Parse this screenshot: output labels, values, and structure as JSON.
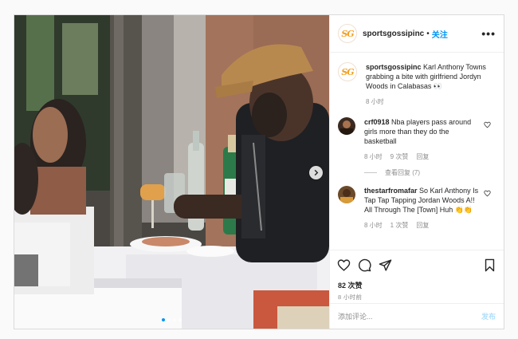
{
  "post": {
    "username": "sportsgossipinc",
    "logo_text": "SG",
    "separator": "•",
    "follow_label": "关注",
    "more_label": "•••",
    "caption": {
      "username": "sportsgossipinc",
      "text": "Karl Anthony Towns grabbing a bite with girlfriend Jordyn Woods in Calabasas 👀",
      "time": "8 小时"
    },
    "comments": [
      {
        "username": "crf0918",
        "text": "Nba players pass around girls more than they do the basketball",
        "time": "8 小时",
        "likes": "9 次赞",
        "reply_label": "回复",
        "view_replies": "查看回复 (7)"
      },
      {
        "username": "thestarfromafar",
        "text": "So Karl Anthony Is Tap Tap Tapping Jordan Woods A!! All Through The [Town] Huh 👏👏",
        "time": "8 小时",
        "likes": "1 次赞",
        "reply_label": "回复"
      }
    ],
    "likes_count": "82 次赞",
    "posted_ago": "8 小时前",
    "comment_placeholder": "添加评论...",
    "post_label": "发布"
  },
  "carousel": {
    "total": 4,
    "active_index": 0
  },
  "colors": {
    "accent": "#0095f6",
    "logo": "#f2a01e",
    "muted": "#8e8e8e"
  },
  "icons": [
    "next-arrow-icon",
    "heart-icon",
    "comment-icon",
    "share-icon",
    "bookmark-icon"
  ]
}
